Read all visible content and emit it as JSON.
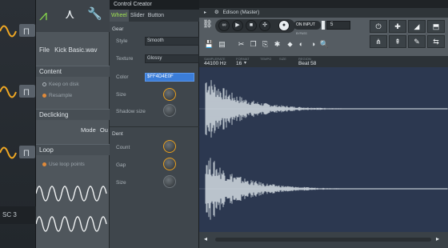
{
  "synth": {
    "waveform_labels": [
      "Π",
      "Π",
      "Π"
    ],
    "bottom_label": "SC 3"
  },
  "channel": {
    "file_label": "File",
    "file_name": "Kick Basic.wav",
    "content_heading": "Content",
    "keep_on_disk": "Keep on disk",
    "resample": "Resample",
    "declicking_heading": "Declicking",
    "mode_label": "Mode",
    "mode_value": "Ou",
    "loop_heading": "Loop",
    "use_loop_points": "Use loop points"
  },
  "control_creator": {
    "title": "Control Creator",
    "tabs": [
      "Wheel",
      "Slider",
      "Button"
    ],
    "active_tab": "Wheel",
    "gear_heading": "Gear",
    "style_label": "Style",
    "style_value": "Smooth",
    "texture_label": "Texture",
    "texture_value": "Glossy",
    "color_label": "Color",
    "color_value": "$FF4D4E0F",
    "size_label": "Size",
    "shadow_label": "Shadow size",
    "dent_heading": "Dent",
    "count_label": "Count",
    "gap_label": "Gap",
    "dent_size_label": "Size",
    "accent": "#f0a824",
    "active_tab_color": "#9fe053"
  },
  "edison": {
    "title": "Edison (Master)",
    "on_input_label": "ON INPUT",
    "on_input_value": "5",
    "bypass_label": "BYPASS",
    "info_labels": [
      "SAMPLERATE",
      "FORMAT",
      "TEMPO",
      "SIZE",
      "REGION"
    ],
    "samplerate": "44100 Hz",
    "format": "16",
    "region": "Beat 58",
    "waveform_color": "#dfe6ec",
    "background_color": "#2c3850",
    "transport_icons": [
      "loop-icon",
      "play-icon",
      "stop-icon",
      "record-icon"
    ],
    "tool_icons": [
      "save-icon",
      "export-icon",
      "cut-icon",
      "copy-icon",
      "paste-icon",
      "normalize-icon",
      "envelope-icon",
      "fade-icon",
      "zoom-icon",
      "scroll-icon",
      "magnify-icon"
    ],
    "grid_icons": [
      "power-icon",
      "add-marker-icon",
      "ramp-icon",
      "flip-icon",
      "split-icon",
      "tune-icon",
      "fade-icon",
      "reverse-icon"
    ]
  }
}
